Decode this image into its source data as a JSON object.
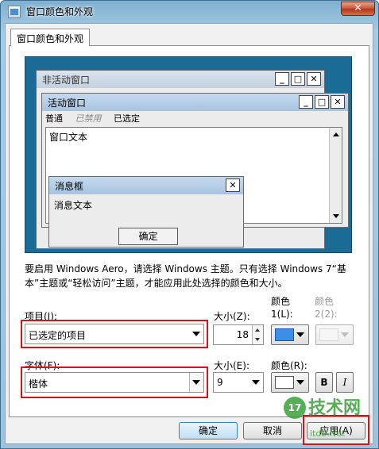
{
  "window": {
    "title": "窗口颜色和外观",
    "close": "✕"
  },
  "tabs": [
    {
      "label": "窗口颜色和外观"
    }
  ],
  "preview": {
    "inactive_title": "非活动窗口",
    "active_title": "活动窗口",
    "menu": [
      "普通",
      "已禁用",
      "已选定"
    ],
    "window_text": "窗口文本",
    "msg_title": "消息框",
    "msg_text": "消息文本",
    "msg_ok": "确定",
    "min": "_",
    "max": "□",
    "close": "✕"
  },
  "help_text": "要启用 Windows Aero，请选择 Windows 主题。只有选择 Windows 7“基本”主题或“轻松访问”主题，才能应用此处选择的颜色和大小。",
  "item": {
    "label": "项目(I):",
    "value": "已选定的项目",
    "size_label": "大小(Z):",
    "size_value": "18",
    "color1_label": "颜色 1(L):",
    "color1": "#3d8fe6",
    "color2_label": "颜色 2(2):"
  },
  "font": {
    "label": "字体(F):",
    "value": "楷体",
    "size_label": "大小(E):",
    "size_value": "9",
    "color_label": "颜色(R):",
    "color": "#ffffff",
    "bold": "B",
    "italic": "I"
  },
  "buttons": {
    "ok": "确定",
    "cancel": "取消",
    "apply": "应用(A)"
  },
  "watermark": {
    "main": "技术网",
    "sub": "itdb.Net",
    "num": "17"
  }
}
